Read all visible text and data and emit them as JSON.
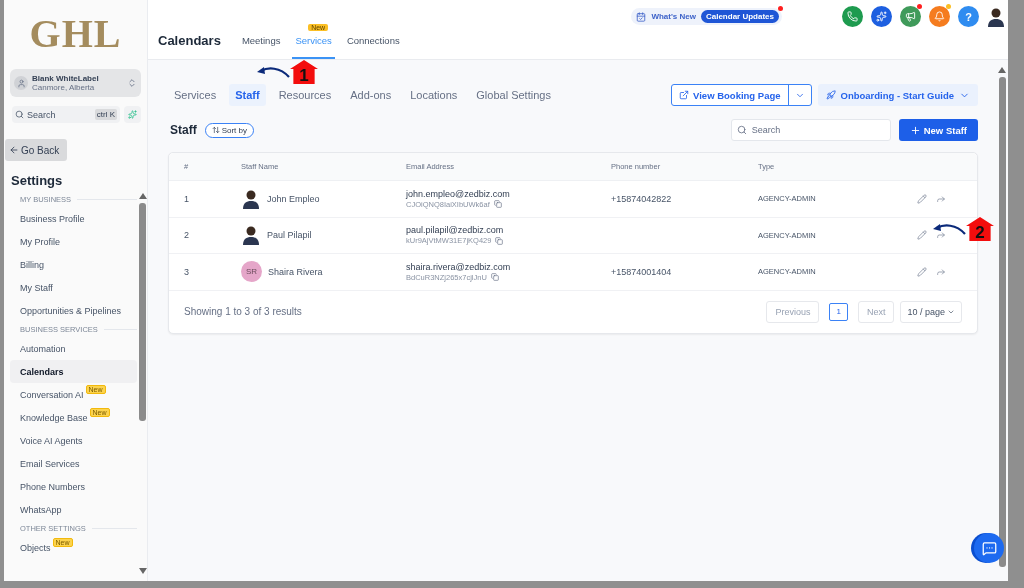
{
  "sidebar": {
    "logo": "GHL",
    "account": {
      "name": "Blank WhiteLabel",
      "location": "Canmore, Alberta"
    },
    "search": {
      "placeholder": "Search",
      "shortcut": "ctrl K"
    },
    "back": "Go Back",
    "title": "Settings",
    "sections": [
      {
        "label": "MY BUSINESS",
        "items": [
          {
            "label": "Business Profile",
            "selected": false
          },
          {
            "label": "My Profile",
            "selected": false
          },
          {
            "label": "Billing",
            "selected": false
          },
          {
            "label": "My Staff",
            "selected": false
          },
          {
            "label": "Opportunities & Pipelines",
            "selected": false
          }
        ]
      },
      {
        "label": "BUSINESS SERVICES",
        "items": [
          {
            "label": "Automation",
            "selected": false
          },
          {
            "label": "Calendars",
            "selected": true
          },
          {
            "label": "Conversation AI",
            "selected": false,
            "badge": "New"
          },
          {
            "label": "Knowledge Base",
            "selected": false,
            "badge": "New"
          },
          {
            "label": "Voice AI Agents",
            "selected": false
          },
          {
            "label": "Email Services",
            "selected": false
          },
          {
            "label": "Phone Numbers",
            "selected": false
          },
          {
            "label": "WhatsApp",
            "selected": false
          }
        ]
      },
      {
        "label": "OTHER SETTINGS",
        "items": [
          {
            "label": "Objects",
            "selected": false,
            "badge": "New"
          }
        ]
      }
    ]
  },
  "header": {
    "title": "Calendars",
    "tabs": [
      {
        "label": "Meetings",
        "selected": false
      },
      {
        "label": "Services",
        "selected": true,
        "badge": "New"
      },
      {
        "label": "Connections",
        "selected": false
      }
    ],
    "whats_new": "What's New",
    "updates": "Calendar Updates",
    "actions": [
      {
        "kind": "phone",
        "color": "#1e9b4f",
        "dot": false
      },
      {
        "kind": "sparkle",
        "color": "#1d5fe0",
        "dot": false
      },
      {
        "kind": "megaphone",
        "color": "#3f9a5a",
        "dot": true
      },
      {
        "kind": "bell",
        "color": "#f57c1f",
        "dot": true
      },
      {
        "kind": "help",
        "color": "#2f8cf0",
        "dot": false,
        "text": "?"
      }
    ]
  },
  "subtabs": [
    {
      "label": "Services",
      "selected": false
    },
    {
      "label": "Staff",
      "selected": true
    },
    {
      "label": "Resources",
      "selected": false
    },
    {
      "label": "Add-ons",
      "selected": false
    },
    {
      "label": "Locations",
      "selected": false
    },
    {
      "label": "Global Settings",
      "selected": false
    }
  ],
  "booking_button": "View Booking Page",
  "guide_button": "Onboarding - Start Guide",
  "staff": {
    "title": "Staff",
    "sort": "Sort by",
    "search": {
      "placeholder": "Search"
    },
    "new_button": "New Staff"
  },
  "table": {
    "columns": [
      "#",
      "Staff Name",
      "Email Address",
      "Phone number",
      "Type"
    ],
    "rows": [
      {
        "index": "1",
        "name": "John Empleo",
        "avatar": {
          "kind": "photo"
        },
        "email": "john.empleo@zedbiz.com",
        "id": "CJOiQNQ8IaiXIbUWk6af",
        "phone": "+15874042822",
        "type": "AGENCY-ADMIN"
      },
      {
        "index": "2",
        "name": "Paul Pilapil",
        "avatar": {
          "kind": "photo"
        },
        "email": "paul.pilapil@zedbiz.com",
        "id": "kUr9AjVtMW31E7jKQ429",
        "type": "AGENCY-ADMIN"
      },
      {
        "index": "3",
        "name": "Shaira Rivera",
        "avatar": {
          "kind": "initials",
          "text": "SR"
        },
        "email": "shaira.rivera@zedbiz.com",
        "id": "BdCuR3NZj265x7cjlJnU",
        "phone": "+15874001404",
        "type": "AGENCY-ADMIN"
      }
    ],
    "summary": "Showing 1 to 3 of 3 results",
    "pagination": {
      "previous": "Previous",
      "pages": [
        {
          "label": "1",
          "selected": true
        }
      ],
      "next": "Next",
      "page_size": "10 / page"
    }
  },
  "callouts": [
    {
      "number": "1"
    },
    {
      "number": "2"
    }
  ]
}
